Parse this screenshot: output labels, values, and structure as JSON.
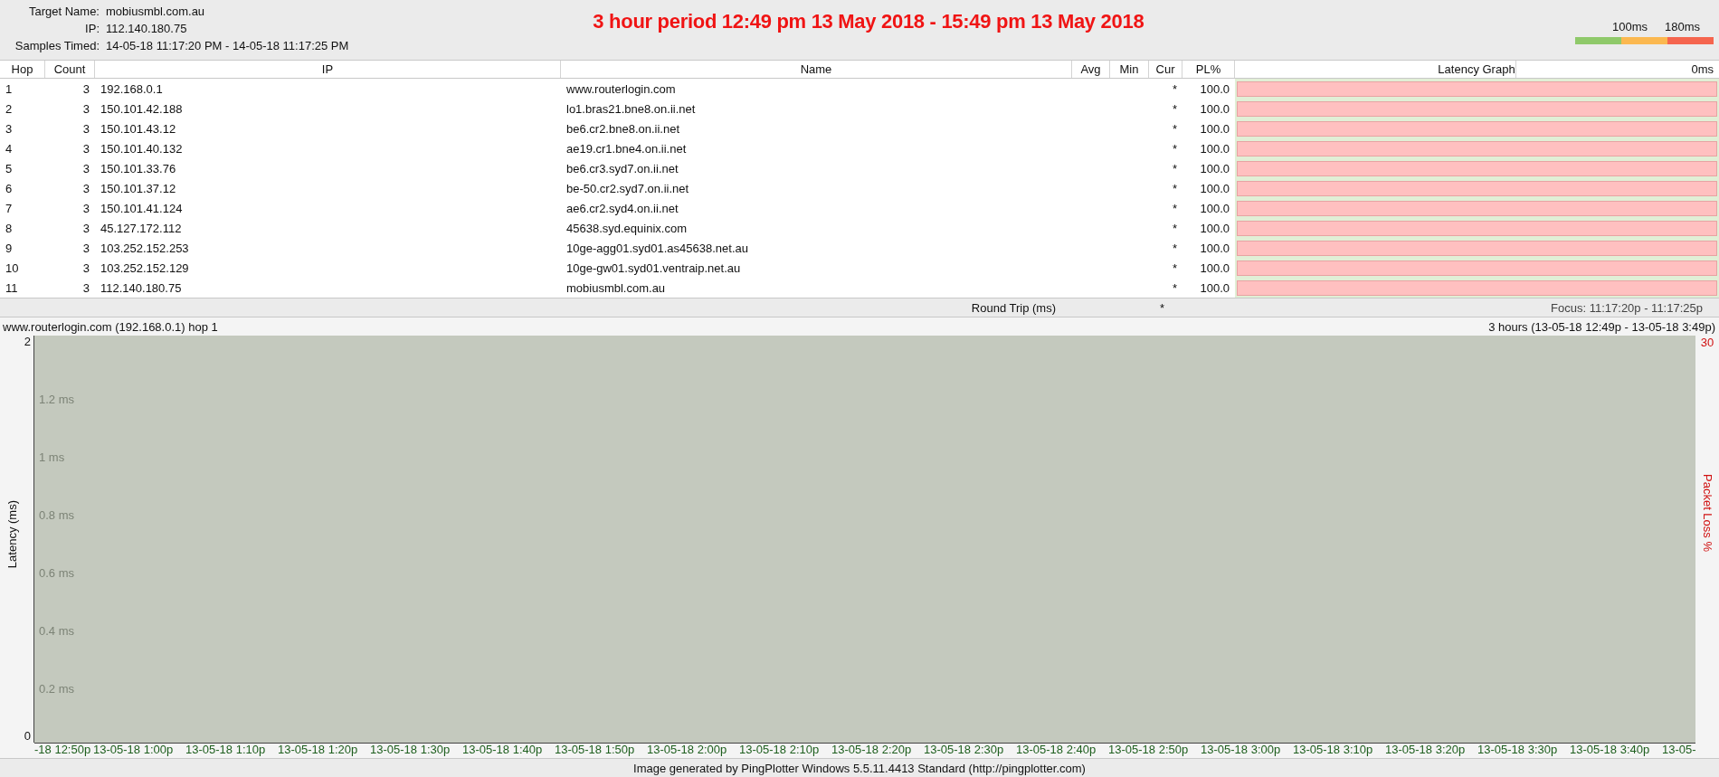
{
  "target": {
    "fields": [
      {
        "label": "Target Name:",
        "value": "mobiusmbl.com.au"
      },
      {
        "label": "IP:",
        "value": "112.140.180.75"
      },
      {
        "label": "Samples Timed:",
        "value": "14-05-18 11:17:20 PM - 14-05-18 11:17:25 PM"
      }
    ],
    "annotation": "3 hour period 12:49 pm 13 May 2018 - 15:49 pm 13 May 2018",
    "legend": {
      "labels": [
        "100ms",
        "180ms"
      ],
      "segments": [
        {
          "color": "#8fc96a"
        },
        {
          "color": "#fbb850"
        },
        {
          "color": "#f5654e"
        }
      ]
    }
  },
  "table": {
    "columns": [
      "Hop",
      "Count",
      "IP",
      "Name",
      "Avg",
      "Min",
      "Cur",
      "PL%",
      "Latency Graph"
    ],
    "graph_scale_label": "0ms",
    "rows": [
      {
        "hop": "1",
        "count": "3",
        "ip": "192.168.0.1",
        "name": "www.routerlogin.com",
        "cur": "*",
        "pl": "100.0"
      },
      {
        "hop": "2",
        "count": "3",
        "ip": "150.101.42.188",
        "name": "lo1.bras21.bne8.on.ii.net",
        "cur": "*",
        "pl": "100.0"
      },
      {
        "hop": "3",
        "count": "3",
        "ip": "150.101.43.12",
        "name": "be6.cr2.bne8.on.ii.net",
        "cur": "*",
        "pl": "100.0"
      },
      {
        "hop": "4",
        "count": "3",
        "ip": "150.101.40.132",
        "name": "ae19.cr1.bne4.on.ii.net",
        "cur": "*",
        "pl": "100.0"
      },
      {
        "hop": "5",
        "count": "3",
        "ip": "150.101.33.76",
        "name": "be6.cr3.syd7.on.ii.net",
        "cur": "*",
        "pl": "100.0"
      },
      {
        "hop": "6",
        "count": "3",
        "ip": "150.101.37.12",
        "name": "be-50.cr2.syd7.on.ii.net",
        "cur": "*",
        "pl": "100.0"
      },
      {
        "hop": "7",
        "count": "3",
        "ip": "150.101.41.124",
        "name": "ae6.cr2.syd4.on.ii.net",
        "cur": "*",
        "pl": "100.0"
      },
      {
        "hop": "8",
        "count": "3",
        "ip": "45.127.172.112",
        "name": "45638.syd.equinix.com",
        "cur": "*",
        "pl": "100.0"
      },
      {
        "hop": "9",
        "count": "3",
        "ip": "103.252.152.253",
        "name": "10ge-agg01.syd01.as45638.net.au",
        "cur": "*",
        "pl": "100.0"
      },
      {
        "hop": "10",
        "count": "3",
        "ip": "103.252.152.129",
        "name": "10ge-gw01.syd01.ventraip.net.au",
        "cur": "*",
        "pl": "100.0"
      },
      {
        "hop": "11",
        "count": "3",
        "ip": "112.140.180.75",
        "name": "mobiusmbl.com.au",
        "cur": "*",
        "pl": "100.0"
      }
    ],
    "summary": {
      "label": "Round Trip (ms)",
      "cur": "*",
      "focus": "Focus: 11:17:20p - 11:17:25p"
    }
  },
  "graph": {
    "title": "www.routerlogin.com (192.168.0.1) hop 1",
    "range": "3 hours (13-05-18 12:49p - 13-05-18 3:49p)",
    "y_axis_label": "Latency (ms)",
    "y_max": "2",
    "y_min": "0",
    "grid_labels": [
      "1.2 ms",
      "1 ms",
      "0.8 ms",
      "0.6 ms",
      "0.4 ms",
      "0.2 ms"
    ],
    "x_labels": [
      "-18 12:50p",
      "13-05-18 1:00p",
      "13-05-18 1:10p",
      "13-05-18 1:20p",
      "13-05-18 1:30p",
      "13-05-18 1:40p",
      "13-05-18 1:50p",
      "13-05-18 2:00p",
      "13-05-18 2:10p",
      "13-05-18 2:20p",
      "13-05-18 2:30p",
      "13-05-18 2:40p",
      "13-05-18 2:50p",
      "13-05-18 3:00p",
      "13-05-18 3:10p",
      "13-05-18 3:20p",
      "13-05-18 3:30p",
      "13-05-18 3:40p",
      "13-05-"
    ],
    "loss_axis_label": "Packet Loss %",
    "loss_max": "30"
  },
  "footer": "Image generated by PingPlotter Windows 5.5.11.4413 Standard (http://pingplotter.com)"
}
